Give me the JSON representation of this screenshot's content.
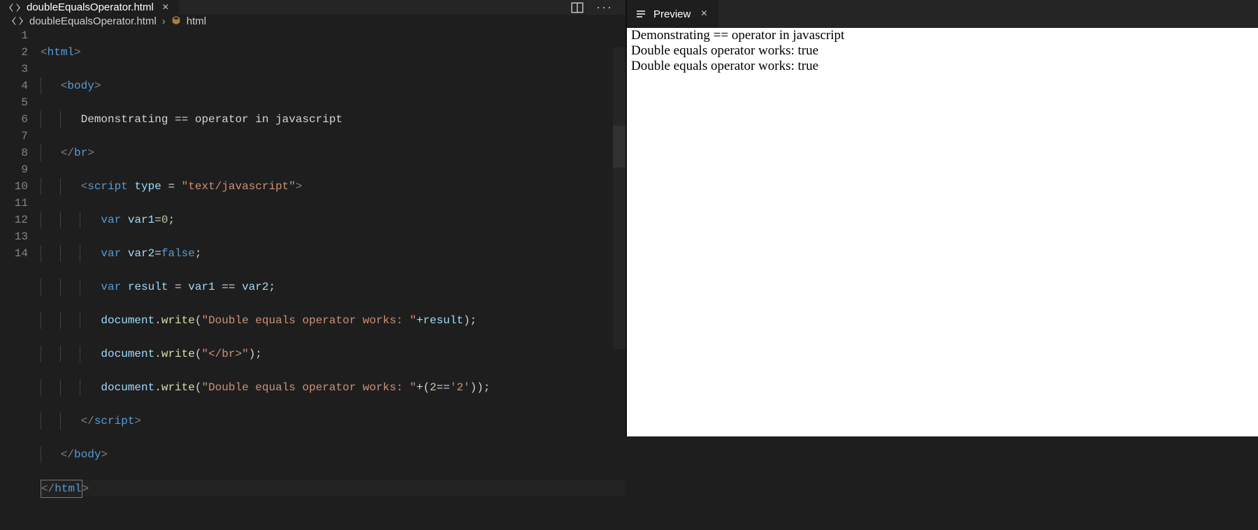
{
  "tabs": {
    "editor": {
      "label": "doubleEqualsOperator.html"
    },
    "preview": {
      "label": "Preview"
    }
  },
  "breadcrumbs": {
    "file": "doubleEqualsOperator.html",
    "symbol": "html"
  },
  "lineNumbers": [
    "1",
    "2",
    "3",
    "4",
    "5",
    "6",
    "7",
    "8",
    "9",
    "10",
    "11",
    "12",
    "13",
    "14"
  ],
  "code": {
    "l1": {
      "tag_open": "<",
      "tag": "html",
      "tag_close": ">"
    },
    "l2": {
      "tag_open": "<",
      "tag": "body",
      "tag_close": ">"
    },
    "l3": {
      "text": "Demonstrating == operator in javascript"
    },
    "l4": {
      "tag_open": "</",
      "tag": "br",
      "tag_close": ">"
    },
    "l5": {
      "tag_open": "<",
      "tag": "script",
      "attr": "type",
      "eq": " = ",
      "val": "\"text/javascript\"",
      "tag_close": ">"
    },
    "l6": {
      "kw": "var",
      "name": " var1",
      "eq": "=",
      "val": "0",
      "semi": ";"
    },
    "l7": {
      "kw": "var",
      "name": " var2",
      "eq": "=",
      "val": "false",
      "semi": ";"
    },
    "l8": {
      "kw": "var",
      "name": " result ",
      "eq": "= ",
      "lhs": "var1 ",
      "op": "== ",
      "rhs": "var2",
      "semi": ";"
    },
    "l9": {
      "obj": "document",
      "dot": ".",
      "fn": "write",
      "open": "(",
      "str": "\"Double equals operator works: \"",
      "plus": "+",
      "var": "result",
      "close": ")",
      "semi": ";"
    },
    "l10": {
      "obj": "document",
      "dot": ".",
      "fn": "write",
      "open": "(",
      "str": "\"</br>\"",
      "close": ")",
      "semi": ";"
    },
    "l11": {
      "obj": "document",
      "dot": ".",
      "fn": "write",
      "open": "(",
      "str": "\"Double equals operator works: \"",
      "plus": "+(",
      "num": "2",
      "op": "==",
      "str2": "'2'",
      "close": "))",
      "semi": ";"
    },
    "l12": {
      "tag_open": "</",
      "tag": "script",
      "tag_close": ">"
    },
    "l13": {
      "tag_open": "</",
      "tag": "body",
      "tag_close": ">"
    },
    "l14": {
      "tag_open": "</",
      "tag": "html",
      "tag_close": ">"
    }
  },
  "preview": {
    "line1": "Demonstrating == operator in javascript",
    "line2": "Double equals operator works: true",
    "line3": "Double equals operator works: true"
  }
}
